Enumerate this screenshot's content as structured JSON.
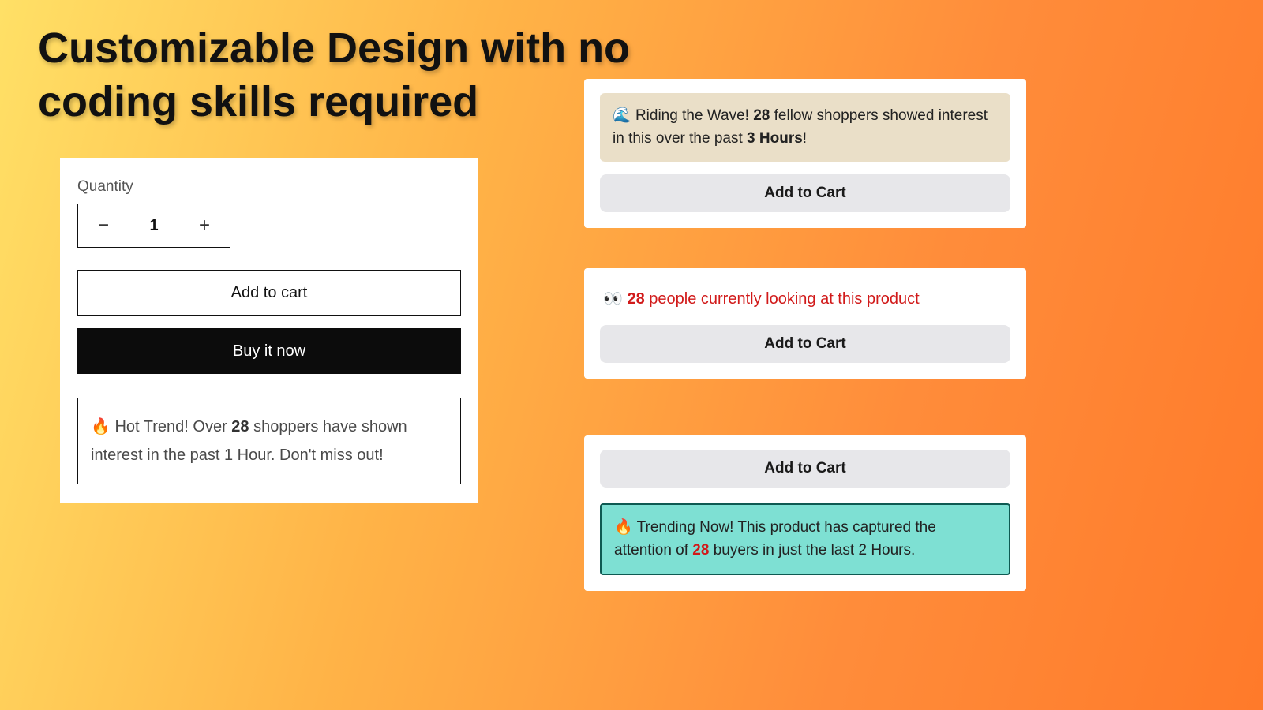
{
  "headline": "Customizable Design with no coding skills required",
  "left": {
    "quantity_label": "Quantity",
    "minus": "−",
    "value": "1",
    "plus": "+",
    "add_to_cart": "Add to cart",
    "buy_now": "Buy it now",
    "trend": {
      "emoji": "🔥",
      "lead": " Hot Trend! Over ",
      "count": "28",
      "tail": " shoppers have shown interest in the past 1 Hour. Don't miss out!"
    }
  },
  "r1": {
    "notice": {
      "emoji": "🌊",
      "lead": " Riding the Wave! ",
      "count": "28",
      "mid": " fellow shoppers showed interest in this over the past ",
      "time": "3 Hours",
      "tail": "!"
    },
    "cta": "Add to Cart"
  },
  "r2": {
    "notice": {
      "emoji": "👀",
      "count": "28",
      "tail": " people currently looking at this product"
    },
    "cta": "Add to Cart"
  },
  "r3": {
    "cta": "Add to Cart",
    "notice": {
      "emoji": "🔥",
      "lead": " Trending Now! This product has captured the attention of ",
      "count": "28",
      "tail": " buyers in just the last 2 Hours."
    }
  }
}
